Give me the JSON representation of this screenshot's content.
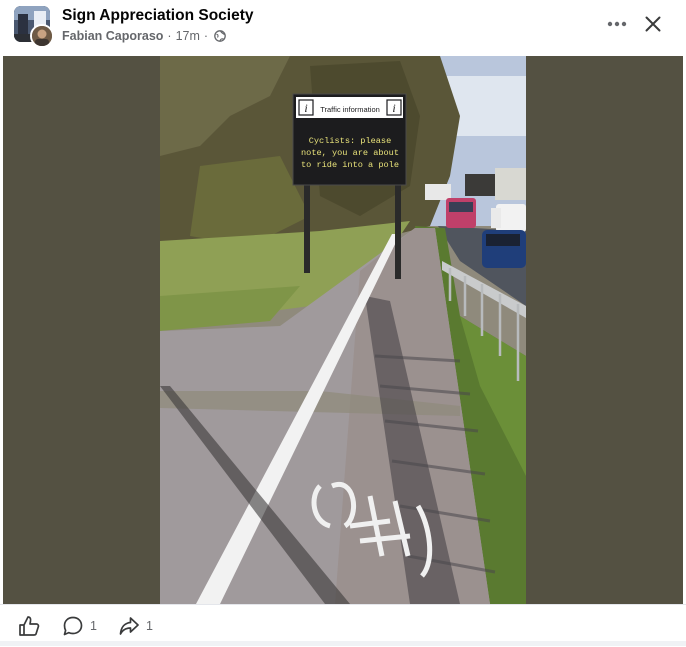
{
  "post": {
    "group_name": "Sign Appreciation Society",
    "author": "Fabian Caporaso",
    "time": "17m",
    "separator": "·",
    "privacy_icon": "globe-icon",
    "more_icon": "more-horizontal-icon",
    "close_icon": "close-icon"
  },
  "photo": {
    "sign_header": "Traffic information",
    "sign_line1": "Cyclists: please",
    "sign_line2": "note, you are about",
    "sign_line3": "to ride into a pole"
  },
  "footer": {
    "like_icon": "thumbs-up-icon",
    "comment_icon": "comment-icon",
    "comment_count": "1",
    "share_icon": "share-icon",
    "share_count": "1"
  },
  "colors": {
    "media_background": "#545142",
    "meta_text": "#65676b",
    "sign_text": "#e8e27a"
  }
}
